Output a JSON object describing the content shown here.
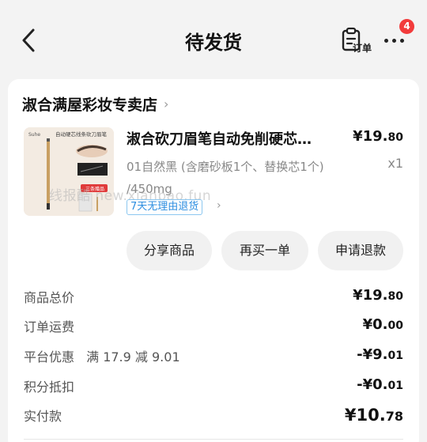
{
  "header": {
    "title": "待发货",
    "order_icon_label": "订单",
    "badge_count": "4"
  },
  "shop": {
    "name": "淑合满屋彩妆专卖店",
    "chevron": "›"
  },
  "product": {
    "name": "淑合砍刀眉笔自动免削硬芯…",
    "price_main": "¥19.",
    "price_cents": "80",
    "variant": "01自然黑 (含磨砂板1个、替换芯1个) /450mg",
    "quantity": "x1",
    "tag": "7天无理由退货",
    "watermark": "线报酷 new.xianbao.fun",
    "thumb_text": {
      "brand": "Suhe",
      "headline": "自动硬芯线条砍刀眉笔",
      "promo": "三条赠品"
    }
  },
  "actions": [
    {
      "label": "分享商品"
    },
    {
      "label": "再买一单"
    },
    {
      "label": "申请退款"
    }
  ],
  "summary": {
    "goods_total": {
      "label": "商品总价",
      "main": "¥19.",
      "cents": "80"
    },
    "shipping": {
      "label": "订单运费",
      "main": "¥0.",
      "cents": "00"
    },
    "platform_discount": {
      "label": "平台优惠",
      "note": "满 17.9 减 9.01",
      "main": "-¥9.",
      "cents": "01"
    },
    "points": {
      "label": "积分抵扣",
      "main": "-¥0.",
      "cents": "01"
    },
    "paid": {
      "label": "实付款",
      "main": "¥10.",
      "cents": "78"
    }
  }
}
